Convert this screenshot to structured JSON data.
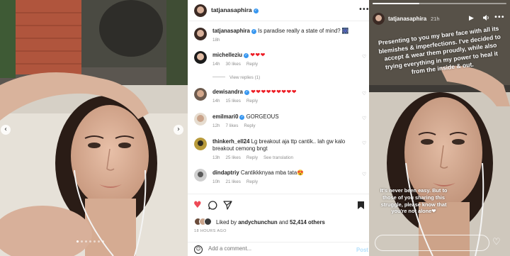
{
  "carousel": {
    "prev_icon": "‹",
    "next_icon": "›",
    "dot_count": 7,
    "active_dot": 0
  },
  "post": {
    "username": "tatjanasaphira",
    "verified_mark": "✓",
    "more_icon": "•••",
    "caption": {
      "username": "tatjanasaphira",
      "text": "Is paradise really a state of mind? 🎆",
      "time": "18h"
    },
    "comments": [
      {
        "username": "michelleziu",
        "text": "❤❤❤",
        "time": "14h",
        "likes": "30 likes",
        "reply": "Reply",
        "translate": ""
      },
      {
        "username": "dewisandra",
        "text": "❤❤❤❤❤❤❤❤❤",
        "time": "14h",
        "likes": "15 likes",
        "reply": "Reply",
        "translate": ""
      },
      {
        "username": "emilmari0",
        "text": "GORGEOUS",
        "time": "12h",
        "likes": "7 likes",
        "reply": "Reply",
        "translate": ""
      },
      {
        "username": "thinkerh_ell24",
        "text": "Lg breakout aja ttp cantik.. lah gw kalo breakout cemong bngt",
        "time": "13h",
        "likes": "25 likes",
        "reply": "Reply",
        "translate": "See translation"
      },
      {
        "username": "dindaptriy",
        "text": "Cantikkknyaa mba tata😍",
        "time": "10h",
        "likes": "21 likes",
        "reply": "Reply",
        "translate": ""
      }
    ],
    "view_replies": "View replies (1)",
    "liked_by_prefix": "Liked by",
    "liked_by_user": "andychunchun",
    "liked_by_and": "and",
    "liked_by_count": "52,414 others",
    "time_ago": "18 HOURS AGO",
    "add_comment_placeholder": "Add a comment...",
    "post_label": "Post",
    "icons": {
      "like": "heart-icon",
      "comment": "comment-icon",
      "share": "share-icon",
      "save": "bookmark-icon",
      "emoji": "emoji-icon"
    },
    "like_glyph": "♥",
    "comment_glyph": "◯",
    "share_glyph": "➤",
    "save_glyph": "▮",
    "heart_outline_glyph": "♡",
    "emoji_glyph": "☺"
  },
  "story": {
    "username": "tatjanasaphira",
    "time": "21h",
    "progress": 0.35,
    "play_glyph": "▶",
    "sound_glyph": "🔈",
    "more_glyph": "•••",
    "caption_top": "Presenting to you my bare face with all its blemishes & imperfections. I've decided to accept & wear them proudly, while also trying everything in my power to heal it from the inside & out.",
    "caption_bottom": "It's never been easy. But to those of you sharing this struggle, please know that you're not alone❤",
    "heart_glyph": "♡"
  },
  "colors": {
    "like_red": "#ed4956",
    "verified_blue": "#3897f0",
    "muted_text": "#8e8e8e",
    "post_button": "#b2dffc"
  }
}
